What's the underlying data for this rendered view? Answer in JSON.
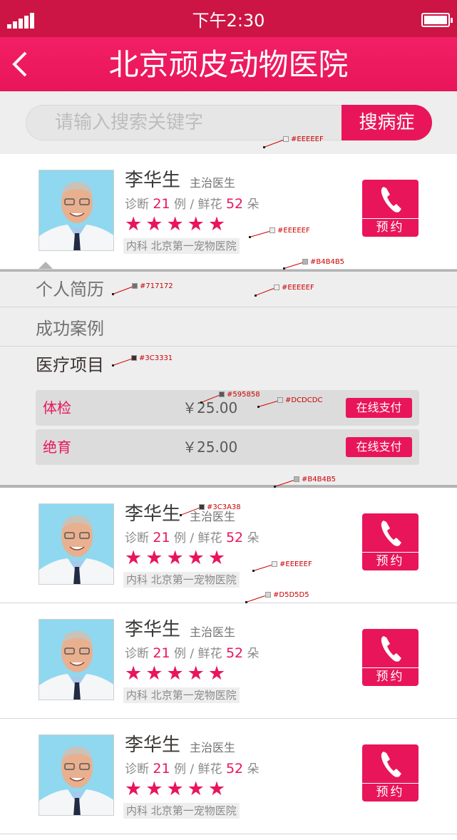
{
  "status_bar": {
    "time": "下午2:30"
  },
  "header": {
    "title": "北京顽皮动物医院"
  },
  "search": {
    "placeholder": "请输入搜索关键字",
    "button_label": "搜病症"
  },
  "doctor_labels": {
    "stats_prefix": "诊断",
    "cases_unit": "例 /",
    "flowers_label": "鲜花",
    "flowers_unit": "朵",
    "book_label": "预约"
  },
  "doctors": [
    {
      "name": "李华生",
      "title": "主治医生",
      "cases": "21",
      "flowers": "52",
      "rating": 5,
      "department": "内科 北京第一宠物医院"
    },
    {
      "name": "李华生",
      "title": "主治医生",
      "cases": "21",
      "flowers": "52",
      "rating": 5,
      "department": "内科 北京第一宠物医院"
    },
    {
      "name": "李华生",
      "title": "主治医生",
      "cases": "21",
      "flowers": "52",
      "rating": 5,
      "department": "内科 北京第一宠物医院"
    },
    {
      "name": "李华生",
      "title": "主治医生",
      "cases": "21",
      "flowers": "52",
      "rating": 5,
      "department": "内科 北京第一宠物医院"
    }
  ],
  "detail_panel": {
    "tabs": [
      "个人简历",
      "成功案例",
      "医疗项目"
    ],
    "active_tab": "医疗项目",
    "services": [
      {
        "name": "体检",
        "price": "￥25.00",
        "pay_label": "在线支付"
      },
      {
        "name": "绝育",
        "price": "￥25.00",
        "pay_label": "在线支付"
      }
    ]
  },
  "annotations": [
    {
      "text": "#EEEEEF",
      "swatch": "#eeeeef"
    },
    {
      "text": "#EEEEEF",
      "swatch": "#eeeeef"
    },
    {
      "text": "#B4B4B5",
      "swatch": "#b4b4b5"
    },
    {
      "text": "#717172",
      "swatch": "#717172"
    },
    {
      "text": "#EEEEEF",
      "swatch": "#eeeeef"
    },
    {
      "text": "#3C3331",
      "swatch": "#3c3331"
    },
    {
      "text": "#595858",
      "swatch": "#595858"
    },
    {
      "text": "#DCDCDC",
      "swatch": "#dcdcdc"
    },
    {
      "text": "#B4B4B5",
      "swatch": "#b4b4b5"
    },
    {
      "text": "#3C3A38",
      "swatch": "#3c3a38"
    },
    {
      "text": "#EEEEEF",
      "swatch": "#eeeeef"
    },
    {
      "text": "#D5D5D5",
      "swatch": "#d5d5d5"
    }
  ],
  "colors": {
    "accent": "#e8155a",
    "status_bar": "#cc1545",
    "panel_bg": "#eeeeef",
    "divider": "#b4b4b5"
  }
}
